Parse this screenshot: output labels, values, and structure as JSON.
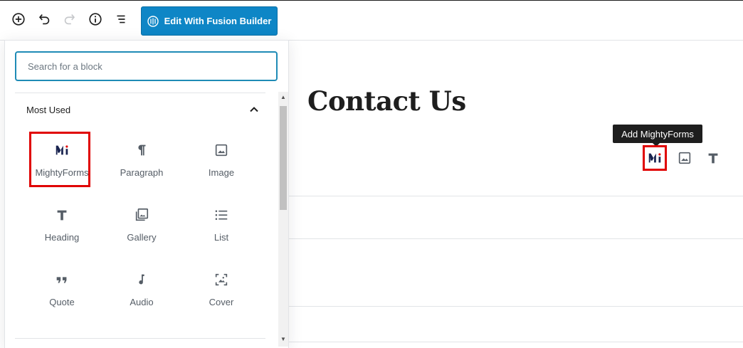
{
  "toolbar": {
    "add_block": "add-block",
    "undo": "undo",
    "redo": "redo",
    "info": "info",
    "outline": "outline",
    "fusion_label": "Edit With Fusion Builder"
  },
  "inserter": {
    "search_placeholder": "Search for a block",
    "section_title": "Most Used",
    "blocks": [
      {
        "label": "MightyForms",
        "icon": "mightyforms-icon"
      },
      {
        "label": "Paragraph",
        "icon": "paragraph-icon"
      },
      {
        "label": "Image",
        "icon": "image-icon"
      },
      {
        "label": "Heading",
        "icon": "heading-icon"
      },
      {
        "label": "Gallery",
        "icon": "gallery-icon"
      },
      {
        "label": "List",
        "icon": "list-icon"
      },
      {
        "label": "Quote",
        "icon": "quote-icon"
      },
      {
        "label": "Audio",
        "icon": "audio-icon"
      },
      {
        "label": "Cover",
        "icon": "cover-icon"
      }
    ]
  },
  "editor": {
    "page_title": "Contact Us",
    "tooltip": "Add MightyForms"
  },
  "colors": {
    "accent": "#0e86c6",
    "highlight": "#e00000",
    "mighty_navy": "#1a2450"
  }
}
